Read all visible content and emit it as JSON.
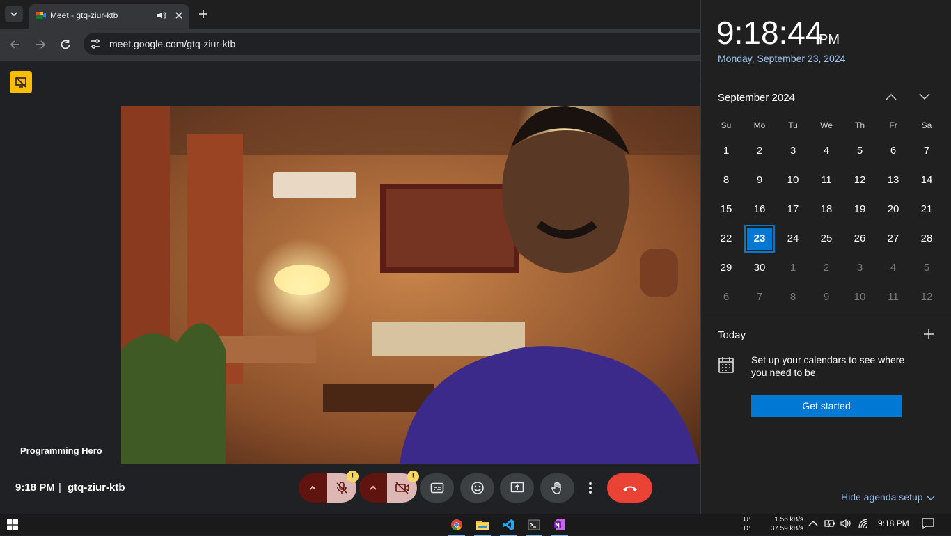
{
  "browser": {
    "tab_title": "Meet - gtq-ziur-ktb",
    "url": "meet.google.com/gtq-ziur-ktb"
  },
  "meet": {
    "participant_name": "Programming Hero",
    "time": "9:18 PM",
    "separator": "|",
    "meeting_code": "gtq-ziur-ktb",
    "warning_mark": "!",
    "colors": {
      "leave": "#ea4335",
      "mic_off_bg": "#dcb7b3",
      "badge": "#fbbc04"
    }
  },
  "flyout": {
    "clock": "9:18:44",
    "ampm": "PM",
    "full_date": "Monday, September 23, 2024",
    "month_title": "September 2024",
    "weekdays": [
      "Su",
      "Mo",
      "Tu",
      "We",
      "Th",
      "Fr",
      "Sa"
    ],
    "weeks": [
      [
        "1",
        "2",
        "3",
        "4",
        "5",
        "6",
        "7"
      ],
      [
        "8",
        "9",
        "10",
        "11",
        "12",
        "13",
        "14"
      ],
      [
        "15",
        "16",
        "17",
        "18",
        "19",
        "20",
        "21"
      ],
      [
        "22",
        "23",
        "24",
        "25",
        "26",
        "27",
        "28"
      ],
      [
        "29",
        "30",
        "1",
        "2",
        "3",
        "4",
        "5"
      ],
      [
        "6",
        "7",
        "8",
        "9",
        "10",
        "11",
        "12"
      ]
    ],
    "selected_day": "23",
    "today_label": "Today",
    "agenda_message": "Set up your calendars to see where you need to be",
    "get_started": "Get started",
    "hide_agenda": "Hide agenda setup"
  },
  "taskbar": {
    "upload_label": "U:",
    "download_label": "D:",
    "upload_speed": "1.56 kB/s",
    "download_speed": "37.59 kB/s",
    "time": "9:18 PM",
    "apps": [
      "chrome-icon",
      "file-explorer-icon",
      "vscode-icon",
      "terminal-icon",
      "onenote-icon"
    ]
  }
}
